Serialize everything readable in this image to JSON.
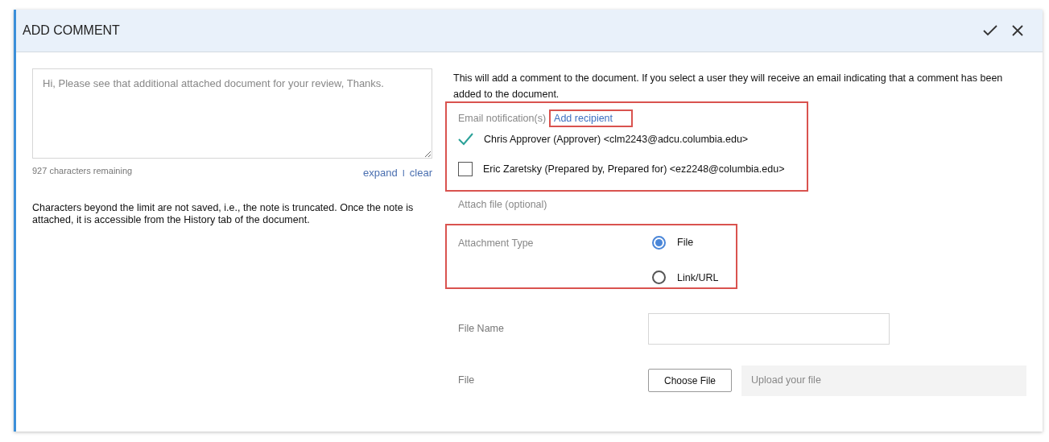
{
  "dialog": {
    "title": "ADD COMMENT"
  },
  "comment": {
    "placeholder": "Hi, Please see that additional attached document for your review, Thanks.",
    "remaining": "927 characters remaining",
    "links": [
      "expand",
      "clear"
    ],
    "separator": "I",
    "note": "Characters beyond the limit are not saved, i.e., the note is truncated. Once the note is attached, it is accessible from the History tab of the document."
  },
  "intro": "This will add a comment to the document. If you select a user they will receive an email indicating that a comment has been added to the document.",
  "email": {
    "label": "Email notification(s)",
    "add_link": "Add recipient",
    "recipients": [
      {
        "label": "Chris Approver (Approver) <clm2243@adcu.columbia.edu>",
        "checked": true
      },
      {
        "label": "Eric Zaretsky (Prepared by, Prepared for) <ez2248@columbia.edu>",
        "checked": false
      }
    ]
  },
  "attach_label": "Attach file (optional)",
  "attachment_type": {
    "label": "Attachment Type",
    "options": [
      {
        "label": "File",
        "selected": true
      },
      {
        "label": "Link/URL",
        "selected": false
      }
    ]
  },
  "file_name": {
    "label": "File Name"
  },
  "file": {
    "label": "File",
    "button": "Choose File",
    "placeholder": "Upload your file"
  }
}
